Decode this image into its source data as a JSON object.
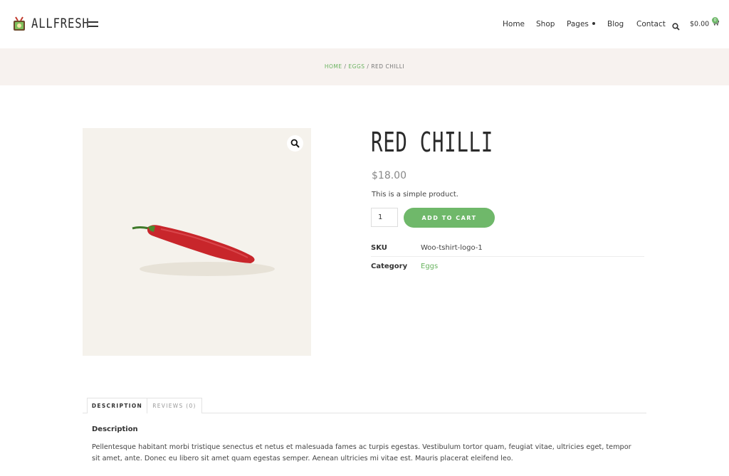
{
  "header": {
    "logo_text": "ALLFRESH",
    "nav": [
      {
        "label": "Home"
      },
      {
        "label": "Shop"
      },
      {
        "label": "Pages"
      },
      {
        "label": "Blog"
      },
      {
        "label": "Contact"
      }
    ],
    "cart_total": "$0.00",
    "cart_count": "0",
    "search_icon": "search-icon",
    "cart_icon": "cart-icon",
    "menu_icon": "hamburger-icon"
  },
  "breadcrumb": {
    "home": "HOME",
    "sep1": " / ",
    "category": "EGGS",
    "sep2": " / ",
    "current": "RED CHILLI"
  },
  "product": {
    "title": "RED CHILLI",
    "price": "$18.00",
    "short_description": "This is a simple product.",
    "quantity": "1",
    "add_to_cart_label": "ADD TO CART",
    "sku_label": "SKU",
    "sku_value": "Woo-tshirt-logo-1",
    "category_label": "Category",
    "category_value": "Eggs",
    "zoom_icon": "magnifier-icon"
  },
  "tabs": [
    {
      "label": "DESCRIPTION",
      "active": true
    },
    {
      "label": "REVIEWS (0)",
      "active": false
    }
  ],
  "description": {
    "heading": "Description",
    "body": "Pellentesque habitant morbi tristique senectus et netus et malesuada fames ac turpis egestas. Vestibulum tortor quam, feugiat vitae, ultricies eget, tempor sit amet, ante. Donec eu libero sit amet quam egestas semper. Aenean ultricies mi vitae est. Mauris placerat eleifend leo."
  },
  "colors": {
    "accent": "#6fb86a",
    "band": "#f7f2ef",
    "image_bg": "#f5f2ec",
    "chilli": "#c8262b"
  }
}
